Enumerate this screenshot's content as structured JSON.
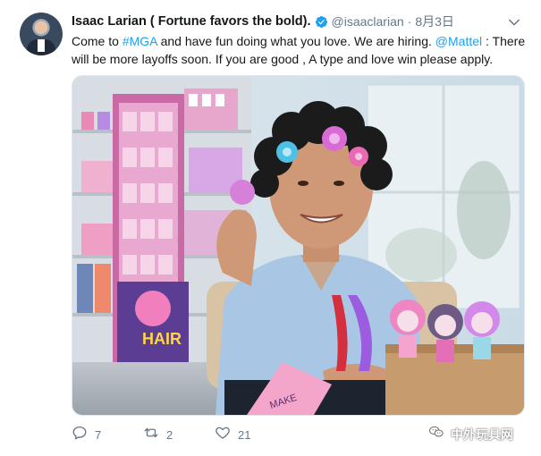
{
  "tweet": {
    "author_name": "Isaac Larian ( Fortune favors the bold).",
    "handle": "@isaaclarian",
    "separator": "·",
    "date": "8月3日",
    "text_parts": {
      "p1": "Come to ",
      "mga_tag": "#MGA",
      "p2": " and have fun doing what you love. We are hiring. ",
      "mattel_mention": "@Mattel",
      "p3": " : There will be more layoffs soon. If you are good , A type and love win please apply."
    },
    "photo": {
      "display_box_text": "HAIR",
      "book_text": "MAKE"
    },
    "actions": {
      "reply_count": "7",
      "retweet_count": "2",
      "like_count": "21"
    },
    "colors": {
      "link": "#1da1f2",
      "verified": "#1da1f2",
      "secondary_text": "#657786"
    }
  },
  "icons": {
    "verified": "verified-badge-icon",
    "more": "chevron-down-icon",
    "reply": "reply-icon",
    "retweet": "retweet-icon",
    "like": "heart-icon",
    "watermark": "wechat-icon"
  },
  "watermark": {
    "text": "中外玩具网"
  }
}
